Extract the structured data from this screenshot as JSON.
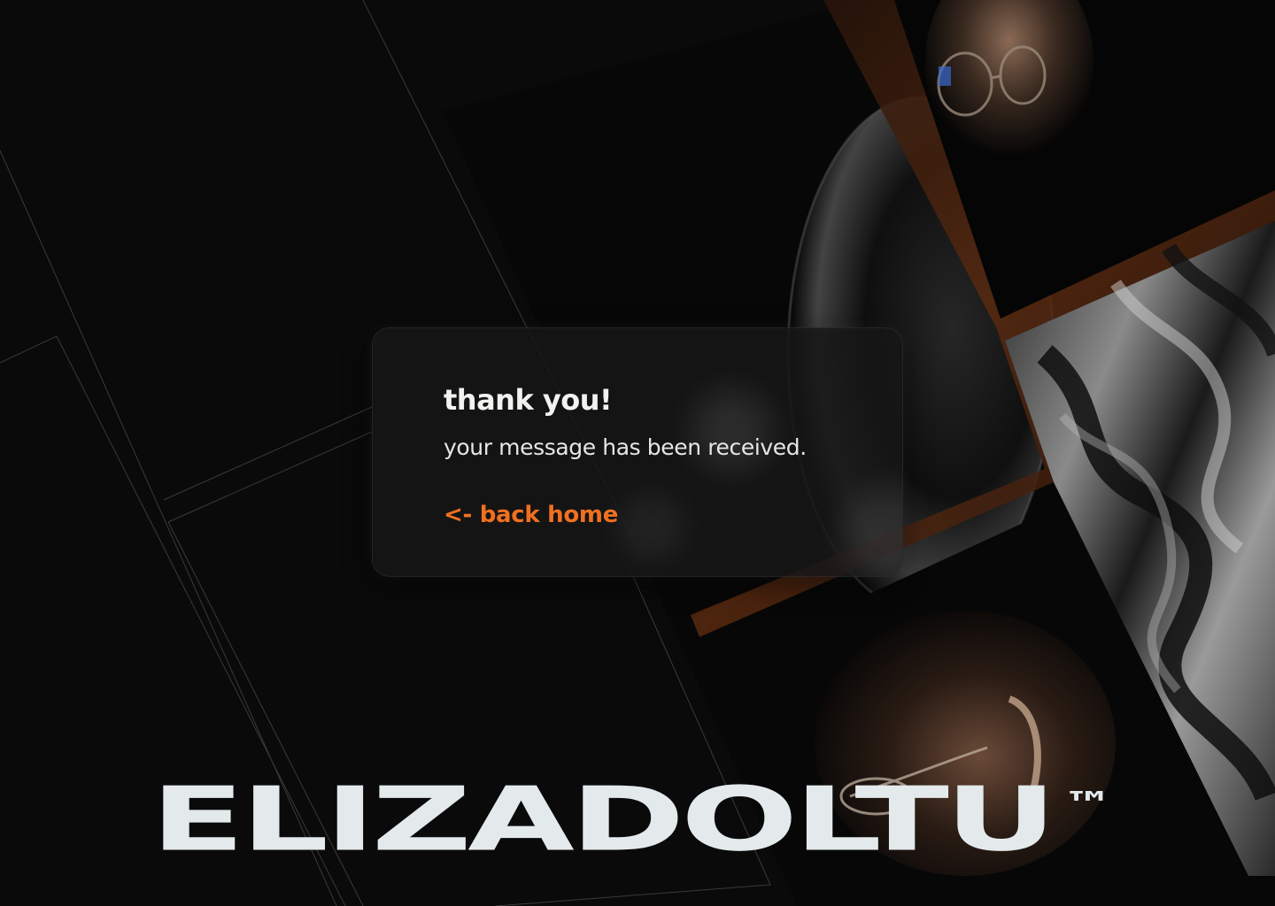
{
  "dialog": {
    "title": "thank you!",
    "message": "your message has been received.",
    "back_link": "<- back home"
  },
  "brand": {
    "name": "ELIZADOLTU",
    "trademark": "™"
  },
  "colors": {
    "background": "#0a0a0a",
    "accent": "#f07020",
    "text": "#f2f2f0",
    "brand_text": "#e4eaec",
    "photo_frame": "#3a1e10"
  },
  "images": [
    {
      "name": "portrait-photo-top",
      "depicts": "woman with glasses"
    },
    {
      "name": "liquid-marble-photo",
      "depicts": "abstract grey liquid texture"
    },
    {
      "name": "portrait-photo-bottom",
      "depicts": "woman with glasses in shadow"
    },
    {
      "name": "dark-sphere-photo",
      "depicts": "dark glossy sphere"
    }
  ]
}
